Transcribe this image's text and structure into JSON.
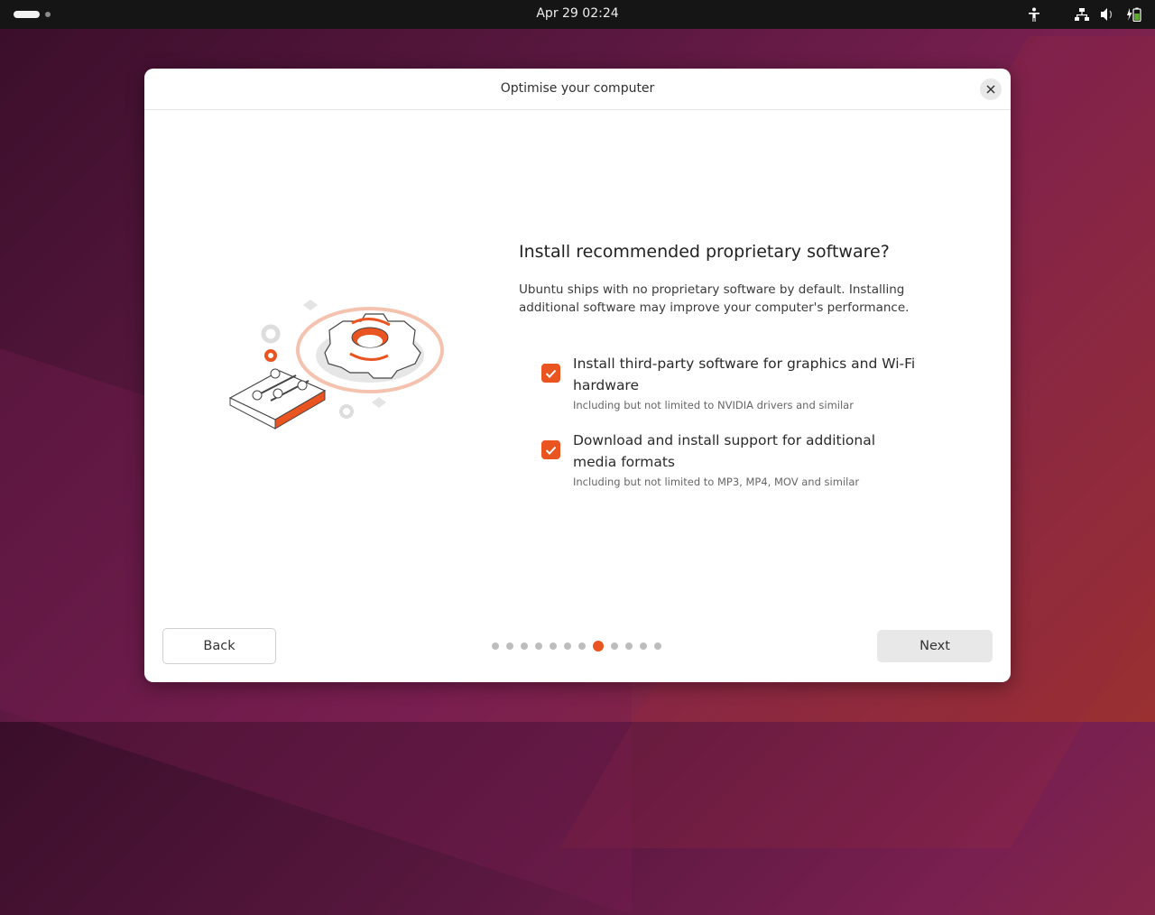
{
  "topbar": {
    "clock": "Apr 29  02:24",
    "icons": [
      "accessibility-icon",
      "network-wired-icon",
      "volume-icon",
      "battery-charging-icon"
    ]
  },
  "dialog": {
    "title": "Optimise your computer",
    "heading": "Install recommended proprietary software?",
    "description": "Ubuntu ships with no proprietary software by default. Installing additional software may improve your computer's performance.",
    "options": [
      {
        "label": "Install third-party software for graphics and Wi-Fi hardware",
        "sublabel": "Including but not limited to NVIDIA drivers and similar",
        "checked": true
      },
      {
        "label": "Download and install support for additional media formats",
        "sublabel": "Including but not limited to MP3, MP4, MOV and similar",
        "checked": true
      }
    ],
    "back_label": "Back",
    "next_label": "Next",
    "pagination": {
      "total": 12,
      "current": 8
    }
  },
  "colors": {
    "accent": "#e95420",
    "topbar": "#151515"
  }
}
